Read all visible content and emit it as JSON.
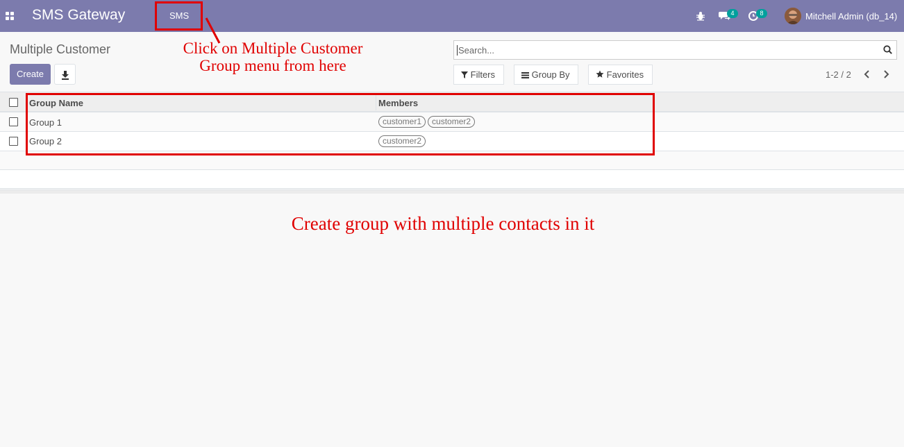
{
  "navbar": {
    "app_title": "SMS Gateway",
    "menu_item": "SMS",
    "messages_count": "4",
    "activities_count": "8",
    "user_name": "Mitchell Admin (db_14)"
  },
  "control_panel": {
    "breadcrumb": "Multiple Customer",
    "create_label": "Create",
    "search_placeholder": "Search...",
    "filters_label": "Filters",
    "group_by_label": "Group By",
    "favorites_label": "Favorites",
    "pager_value": "1-2 / 2"
  },
  "list": {
    "columns": [
      "Group Name",
      "Members"
    ],
    "rows": [
      {
        "name": "Group 1",
        "members": [
          "customer1",
          "customer2"
        ]
      },
      {
        "name": "Group 2",
        "members": [
          "customer2"
        ]
      }
    ]
  },
  "annotations": {
    "menu_hint_line1": "Click on Multiple Customer",
    "menu_hint_line2": "Group menu from here",
    "bottom_hint": "Create group with multiple contacts in it",
    "color": "#e00000"
  },
  "colors": {
    "brand": "#7c7bad",
    "badge": "#00a09d"
  }
}
